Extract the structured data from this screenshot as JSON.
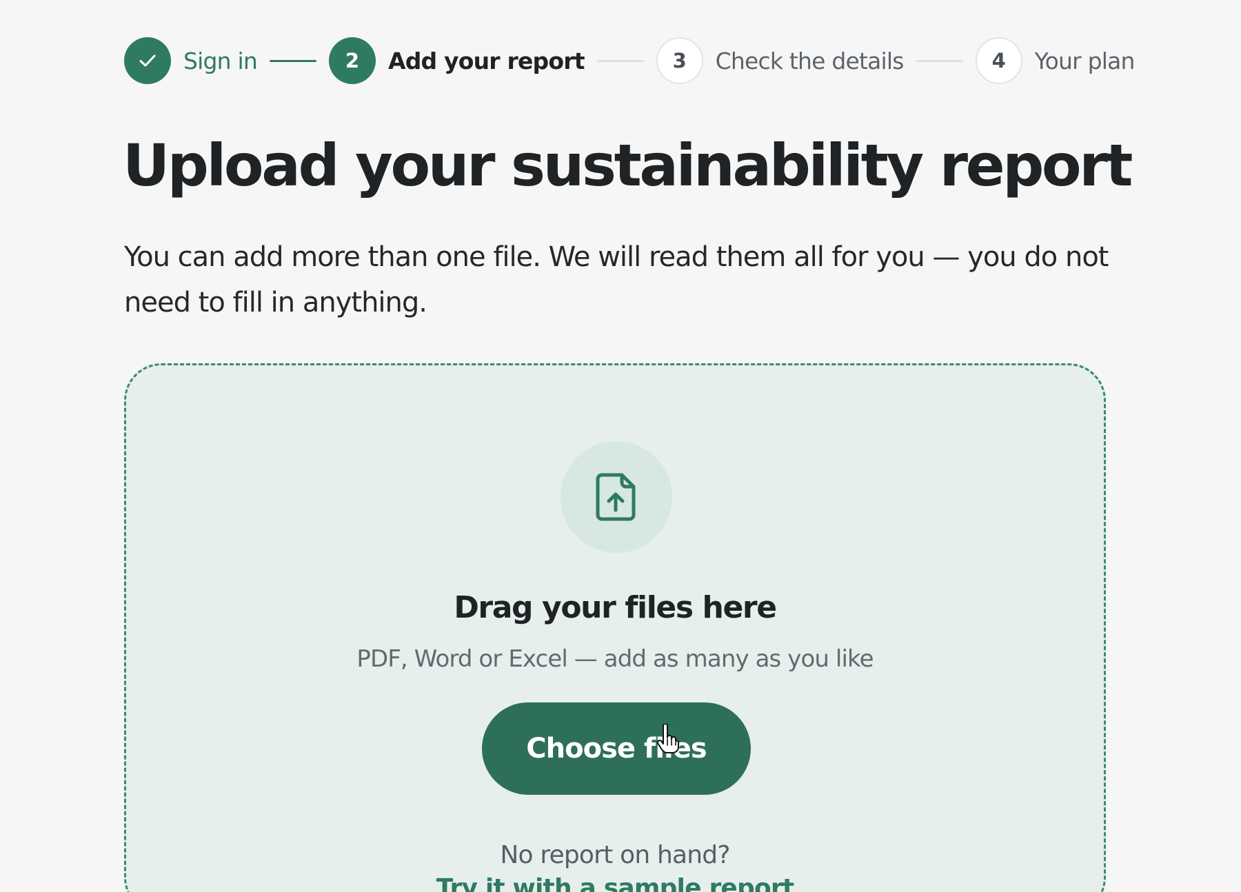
{
  "stepper": {
    "steps": [
      {
        "label": "Sign in",
        "number": "",
        "state": "done"
      },
      {
        "label": "Add your report",
        "number": "2",
        "state": "current"
      },
      {
        "label": "Check the details",
        "number": "3",
        "state": "upcoming"
      },
      {
        "label": "Your plan",
        "number": "4",
        "state": "upcoming"
      }
    ]
  },
  "heading": {
    "title": "Upload your sustainability report",
    "intro": "You can add more than one file. We will read them all for you — you do not need to fill in anything."
  },
  "dropzone": {
    "icon": "file-upload-icon",
    "title": "Drag your files here",
    "subtitle": "PDF, Word or Excel — add as many as you like",
    "button_label": "Choose files",
    "no_report_text": "No report on hand?",
    "sample_link_text": "Try it with a sample report"
  },
  "colors": {
    "accent": "#2f7a62",
    "button": "#2e6f5a",
    "dropzone_bg": "#e6efec",
    "page_bg": "#f6f6f6"
  }
}
